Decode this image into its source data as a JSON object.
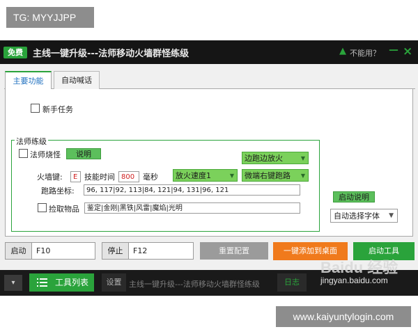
{
  "overlay": {
    "tg_label": "TG: MYYJJPP",
    "site_url": "www.kaiyuntylogin.com"
  },
  "titlebar": {
    "free_badge": "免费",
    "title": "主线一键升级---法师移动火墙群怪练级",
    "help_label": "不能用？",
    "minimize": "－",
    "close": "×",
    "warn_icon": "warning-icon"
  },
  "tabs": [
    {
      "label": "主要功能",
      "active": true
    },
    {
      "label": "自动喊话",
      "active": false
    }
  ],
  "main": {
    "newbie_task": "新手任务",
    "group_title": "法师练级",
    "burn_monsters": "法师烧怪",
    "explain_btn": "说明",
    "dropdown_run_burn": "边跑边放火",
    "firewall_key_label": "火墙键:",
    "firewall_key_value": "E",
    "skill_time_label": "技能时间",
    "skill_time_value": "800",
    "ms_label": "毫秒",
    "dropdown_fire_speed": "放火速度1",
    "dropdown_right_click": "微端右键跑路",
    "path_label": "跑路坐标:",
    "path_value": "96, 117|92, 113|84, 121|94, 131|96, 121",
    "pickup_label": "捡取物品",
    "pickup_value": "鉴定|金刚|黑铁|风雷|魔焰|光明",
    "start_explain": "启动说明",
    "font_select": "自动选择字体"
  },
  "actions": {
    "start_label": "启动",
    "start_key": "F10",
    "stop_label": "停止",
    "stop_key": "F12",
    "reset": "重置配置",
    "add_desktop": "一键添加到桌面",
    "start_tool": "启动工具"
  },
  "bottom": {
    "expand": "▾",
    "tool_list": "工具列表",
    "settings": "设置",
    "title": "主线一键升级---法师移动火墙群怪练级",
    "log": "日志",
    "watermark": "Baidu 经验",
    "watermark_url": "jingyan.baidu.com"
  },
  "colors": {
    "accent_green": "#2aa33b",
    "orange": "#f07a1c",
    "titlebar_bg": "#151515"
  }
}
